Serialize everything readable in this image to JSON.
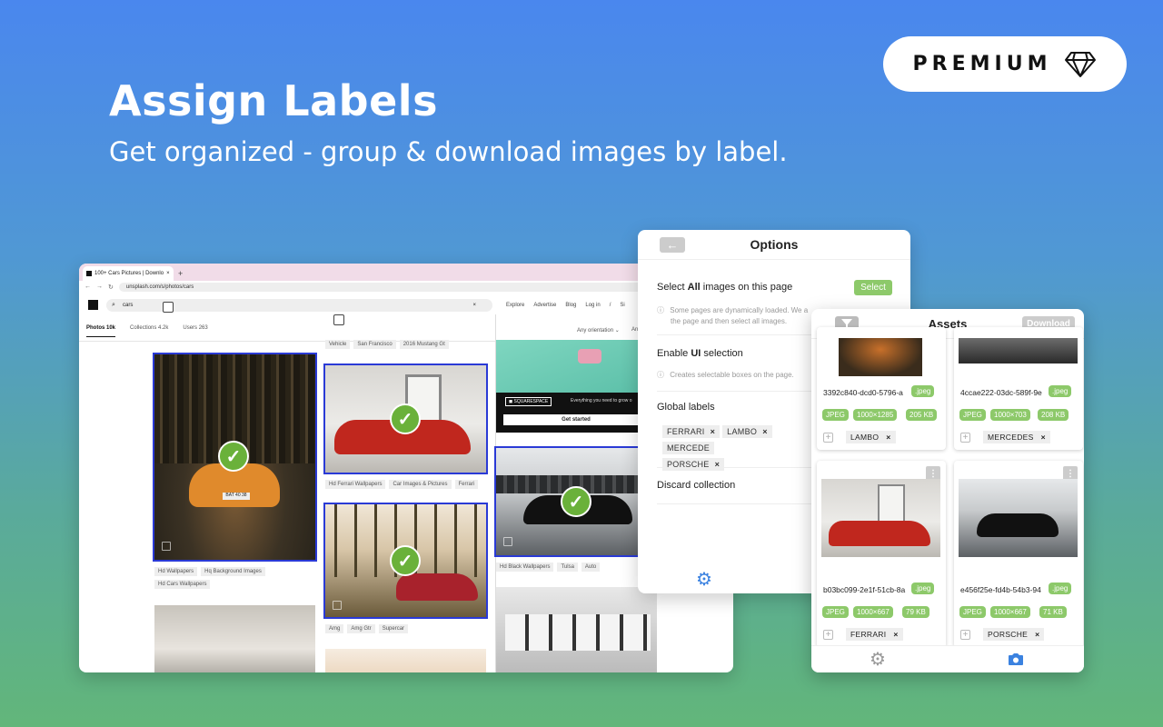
{
  "hero": {
    "title": "Assign Labels",
    "subtitle": "Get organized - group & download images by label.",
    "badge": "PREMIUM"
  },
  "browser": {
    "tab_title": "100+ Cars Pictures | Downlo",
    "tab_close": "×",
    "tab_new": "+",
    "url": "unsplash.com/s/photos/cars",
    "search_value": "cars",
    "nav": [
      "Explore",
      "Advertise",
      "Blog",
      "Log in",
      "/",
      "Si"
    ],
    "filters": [
      "Photos 10k",
      "Collections 4.2k",
      "Users 263"
    ],
    "orientation": "Any orientation ⌄",
    "orientation_more": "An",
    "col1_tags": [
      "Hd Wallpapers",
      "Hq Background Images",
      "Hd Cars Wallpapers"
    ],
    "col2_top_tags": [
      "Vehicle",
      "San Francisco",
      "2016 Mustang Gt"
    ],
    "col2_tags_a": [
      "Hd Ferrari Wallpapers",
      "Car Images & Pictures",
      "Ferrari"
    ],
    "col2_tags_b": [
      "Amg",
      "Amg Gtr",
      "Supercar"
    ],
    "col3_tags": [
      "Hd Black Wallpapers",
      "Tulsa",
      "Auto"
    ],
    "ad_brand": "◼ SQUARESPACE",
    "ad_text": "Everything you need to grow o",
    "ad_button": "Get started",
    "plate": "BAT 40 38"
  },
  "options": {
    "title": "Options",
    "select_all_prefix": "Select ",
    "select_all_bold": "All",
    "select_all_suffix": " images on this page",
    "select_button": "Select",
    "select_hint": "Some pages are dynamically loaded. We a... the page and then select all images.",
    "select_hint_a": "Some pages are dynamically loaded. We a",
    "select_hint_b": "the page and then select all images.",
    "ui_prefix": "Enable ",
    "ui_bold": "UI",
    "ui_suffix": " selection",
    "ui_hint": "Creates selectable boxes on the page.",
    "global_labels": "Global labels",
    "labels": [
      "FERRARI",
      "LAMBO",
      "MERCEDE",
      "PORSCHE"
    ],
    "discard": "Discard collection"
  },
  "assets": {
    "title": "Assets",
    "download": "Download",
    "cards": [
      {
        "name": "3392c840-dcd0-5796-a",
        "ext": ".jpeg",
        "type": "JPEG",
        "dims": "1000×1285",
        "size": "205 KB",
        "label": "LAMBO"
      },
      {
        "name": "4ccae222-03dc-589f-9e",
        "ext": ".jpeg",
        "type": "JPEG",
        "dims": "1000×703",
        "size": "208 KB",
        "label": "MERCEDES"
      },
      {
        "name": "b03bc099-2e1f-51cb-8a",
        "ext": ".jpeg",
        "type": "JPEG",
        "dims": "1000×667",
        "size": "79 KB",
        "label": "FERRARI"
      },
      {
        "name": "e456f25e-fd4b-54b3-94",
        "ext": ".jpeg",
        "type": "JPEG",
        "dims": "1000×667",
        "size": "71 KB",
        "label": "PORSCHE"
      }
    ]
  },
  "colors": {
    "accent": "#3b82e0",
    "green": "#8dc96a",
    "selection": "#2a3ad6"
  },
  "icons": [
    "diamond-icon",
    "gear-icon",
    "camera-icon",
    "filter-icon",
    "back-arrow-icon",
    "check-icon",
    "search-icon",
    "kebab-menu-icon"
  ]
}
